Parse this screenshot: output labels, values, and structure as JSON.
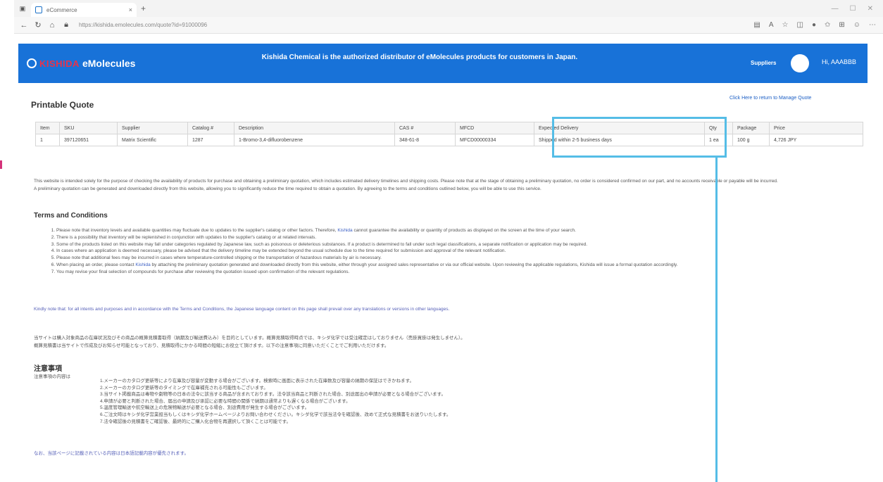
{
  "browser": {
    "tab_title": "eCommerce",
    "url": "https://kishida.emolecules.com/quote?id=91000096",
    "new_tab": "+"
  },
  "header": {
    "logo_brand": "KISHIDA",
    "logo_product": "eMolecules",
    "banner_text": "Kishida Chemical is the authorized distributor of eMolecules products for customers in Japan.",
    "suppliers_link": "Suppliers",
    "greeting": "Hi, AAABBB"
  },
  "page": {
    "title": "Printable Quote",
    "return_link": "Click Here to return to Manage Quote"
  },
  "table": {
    "headers": [
      "Item",
      "SKU",
      "Supplier",
      "Catalog #",
      "Description",
      "CAS #",
      "MFCD",
      "Expected Delivery",
      "Qty",
      "Package",
      "Price"
    ],
    "rows": [
      [
        "1",
        "397120651",
        "Matrix Scientific",
        "1287",
        "1-Bromo-3,4-difluorobenzene",
        "348-61-8",
        "MFCD00000334",
        "Shipped within 2-5 business days",
        "1 ea",
        "100 g",
        "4,726 JPY"
      ]
    ]
  },
  "intro": {
    "line1": "This website is intended solely for the purpose of checking the availability of products for purchase and obtaining a preliminary quotation, which includes estimated delivery timelines and shipping costs. Please note that at the stage of obtaining a preliminary quotation, no order is considered confirmed on our part, and no accounts receivable or payable will be incurred.",
    "line2": "A preliminary quotation can be generated and downloaded directly from this website, allowing you to significantly reduce the time required to obtain a quotation. By agreeing to the terms and conditions outlined below, you will be able to use this service."
  },
  "terms": {
    "title": "Terms and Conditions",
    "items": [
      {
        "before": "Please note that inventory levels and available quantities may fluctuate due to updates to the supplier's catalog or other factors. Therefore, ",
        "link": "Kishida",
        "after": " cannot guarantee the availability or quantity of products as displayed on the screen at the time of your search."
      },
      {
        "before": "There is a possibility that inventory will be replenished in conjunction with updates to the supplier's catalog or at related intervals.",
        "link": "",
        "after": ""
      },
      {
        "before": "Some of the products listed on this website may fall under categories regulated by Japanese law, such as poisonous or deleterious substances. If a product is determined to fall under such legal classifications, a separate notification or application may be required.",
        "link": "",
        "after": ""
      },
      {
        "before": "In cases where an application is deemed necessary, please be advised that the delivery timeline may be extended beyond the usual schedule due to the time required for submission and approval of the relevant notification.",
        "link": "",
        "after": ""
      },
      {
        "before": "Please note that additional fees may be incurred in cases where temperature-controlled shipping or the transportation of hazardous materials by air is necessary.",
        "link": "",
        "after": ""
      },
      {
        "before": "When placing an order, please contact ",
        "link": "Kishida",
        "after": " by attaching the preliminary quotation generated and downloaded directly from this website, either through your assigned sales representative or via our official website. Upon reviewing the applicable regulations, Kishida will issue a formal quotation accordingly."
      },
      {
        "before": "You may revise your final selection of compounds for purchase after reviewing the quotation issued upon confirmation of the relevant regulations.",
        "link": "",
        "after": ""
      }
    ],
    "note": "Kindly note that: for all intents and purposes and in accordance with the Terms and Conditions, the Japanese language content on this page shall prevail over any translations or versions in other languages."
  },
  "japanese": {
    "intro1": "当サイトは購入対象商品の在庫状況及びその商品の概算見積書取得（納期及び輸送費込み）を目的としています。概算見積取得時点では、キシダ化学では受注確定はしておりません（売掛買掛は発生しません）。",
    "intro2": "概算見積書は当サイトで作成及びお知らせ可能となっており、見積取得にかかる時間の短縮にお役立て頂けます。以下の注意事項に同意いただくことでご利用いただけます。",
    "title": "注意事項",
    "sub": "注意事項の内容は",
    "items": [
      "1.メーカーのカタログ更新等により在庫及び容量が変動する場合がございます。検索時に画面に表示された在庫数及び容量の納期の保証はできかねます。",
      "2.メーカーのカタログ更新等のタイミングで在庫補充される可能性もございます。",
      "3.当サイト掲載商品は毒物や劇物等の日本の法令に該当する商品が含まれております。法令該当商品と判断された場合、別途届出の申請が必要となる場合がございます。",
      "4.申請が必要と判断された場合、届出の申請及び承認に必要な時間の関係で納期は通常よりも遅くなる場合がございます。",
      "5.温度管理輸送や航空輸送上の危険物輸送が必要となる場合、別途費用が発生する場合がございます。",
      "6.ご注文時はキシダ化学営業担当もしくはキシダ化学ホームページよりお問い合わせください。キシダ化学で該当法令を確認後、改めて正式な見積書をお送りいたします。",
      "7.法令確認後の見積書をご確認後、最終的にご購入化合物を再選択して頂くことは可能です。"
    ],
    "note": "なお、当該ページに記載されている内容は日本語記載内容が優先されます。"
  }
}
